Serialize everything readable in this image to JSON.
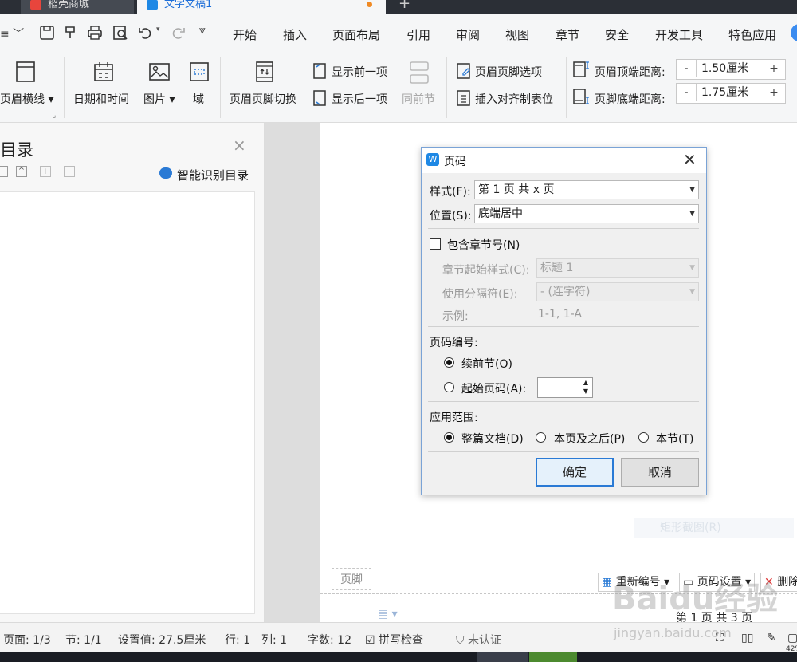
{
  "tabs": [
    {
      "label": "稻壳商城"
    },
    {
      "label": "文字文稿1"
    }
  ],
  "menu": [
    "开始",
    "插入",
    "页面布局",
    "引用",
    "审阅",
    "视图",
    "章节",
    "安全",
    "开发工具",
    "特色应用"
  ],
  "ribbon": {
    "header_line": "页眉横线",
    "date_time": "日期和时间",
    "picture": "图片",
    "field": "域",
    "switch": "页眉页脚切换",
    "show_prev": "显示前一项",
    "show_next": "显示后一项",
    "same_as_prev": "同前节",
    "hf_options": "页眉页脚选项",
    "insert_tab": "插入对齐制表位",
    "header_top_label": "页眉顶端距离:",
    "header_top_value": "1.50厘米",
    "footer_bottom_label": "页脚底端距离:",
    "footer_bottom_value": "1.75厘米",
    "minus": "-",
    "plus": "+"
  },
  "toc_panel": {
    "title": "目录",
    "smart_toc": "智能识别目录",
    "close": "×"
  },
  "dialog": {
    "title": "页码",
    "style_label": "样式(F):",
    "style_value": "第 1 页 共 x 页",
    "position_label": "位置(S):",
    "position_value": "底端居中",
    "include_chapter": "包含章节号(N)",
    "chapter_style_label": "章节起始样式(C):",
    "chapter_style_value": "标题 1",
    "separator_label": "使用分隔符(E):",
    "separator_value": "-    (连字符)",
    "example_label": "示例:",
    "example_value": "1-1, 1-A",
    "numbering_label": "页码编号:",
    "continue_prev": "续前节(O)",
    "start_at": "起始页码(A):",
    "start_value": "",
    "scope_label": "应用范围:",
    "scope_whole": "整篇文档(D)",
    "scope_after": "本页及之后(P)",
    "scope_section": "本节(T)",
    "ok": "确定",
    "cancel": "取消"
  },
  "footer": {
    "tag": "页脚",
    "renumber": "重新编号",
    "page_settings": "页码设置",
    "delete": "删除",
    "page_text": "第 1 页 共 3 页",
    "screenshot_hint": "矩形截图(R)"
  },
  "status": {
    "page": "页面: 1/3",
    "section": "节: 1/1",
    "setting": "设置值: 27.5厘米",
    "row": "行: 1",
    "col": "列: 1",
    "words": "字数: 12",
    "spell": "拼写检查",
    "auth": "未认证",
    "zoom": "42%"
  },
  "watermark": {
    "brand": "Baidu经验",
    "url": "jingyan.baidu.com"
  },
  "colors": {
    "accent": "#2a7ad5",
    "titlebar": "#2b2f36",
    "wps_blue": "#1e88e5"
  }
}
